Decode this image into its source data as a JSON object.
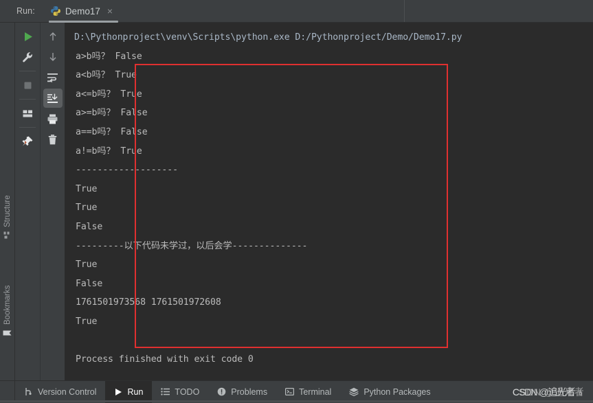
{
  "header": {
    "run_label": "Run:",
    "tab": {
      "title": "Demo17",
      "icon": "python-logo-icon",
      "close_label": "×"
    }
  },
  "left_strip": {
    "items": [
      {
        "label": "Structure",
        "icon": "structure-icon"
      },
      {
        "label": "Bookmarks",
        "icon": "bookmark-icon"
      }
    ]
  },
  "toolbar_left": {
    "buttons": [
      {
        "name": "rerun-button",
        "icon": "play-icon"
      },
      {
        "name": "edit-configurations-button",
        "icon": "wrench-icon"
      },
      {
        "name": "stop-button",
        "icon": "stop-square-icon"
      },
      {
        "name": "layout-button",
        "icon": "layout-icon"
      },
      {
        "name": "pin-tab-button",
        "icon": "pin-icon"
      }
    ]
  },
  "toolbar_right": {
    "buttons": [
      {
        "name": "up-stack-trace-button",
        "icon": "arrow-up-icon"
      },
      {
        "name": "down-stack-trace-button",
        "icon": "arrow-down-icon"
      },
      {
        "name": "soft-wrap-button",
        "icon": "soft-wrap-icon"
      },
      {
        "name": "scroll-to-end-button",
        "icon": "scroll-to-end-icon",
        "active": true
      },
      {
        "name": "print-button",
        "icon": "printer-icon"
      },
      {
        "name": "clear-all-button",
        "icon": "trash-icon"
      }
    ]
  },
  "console": {
    "command": "D:\\Pythonproject\\venv\\Scripts\\python.exe D:/Pythonproject/Demo/Demo17.py",
    "lines": [
      "a>b吗？ False",
      "a<b吗？ True",
      "a<=b吗？ True",
      "a>=b吗？ False",
      "a==b吗？ False",
      "a!=b吗？ True",
      "-------------------",
      "True",
      "True",
      "False",
      "---------以下代码未学过，以后会学--------------",
      "True",
      "False",
      "1761501973568 1761501972608",
      "True"
    ],
    "blank_line": " ",
    "exit_line": "Process finished with exit code 0",
    "highlight_color": "#e03030"
  },
  "bottom_tabs": [
    {
      "label": "Version Control",
      "icon": "branch-icon",
      "active": false
    },
    {
      "label": "Run",
      "icon": "play-icon",
      "active": true
    },
    {
      "label": "TODO",
      "icon": "list-icon",
      "active": false
    },
    {
      "label": "Problems",
      "icon": "warning-icon",
      "active": false
    },
    {
      "label": "Terminal",
      "icon": "terminal-icon",
      "active": false
    },
    {
      "label": "Python Packages",
      "icon": "packages-icon",
      "active": false
    }
  ],
  "watermark": {
    "text": "CSDN @追光者",
    "ghost": "CSDN @追光者",
    "person_glyph": "♁"
  }
}
